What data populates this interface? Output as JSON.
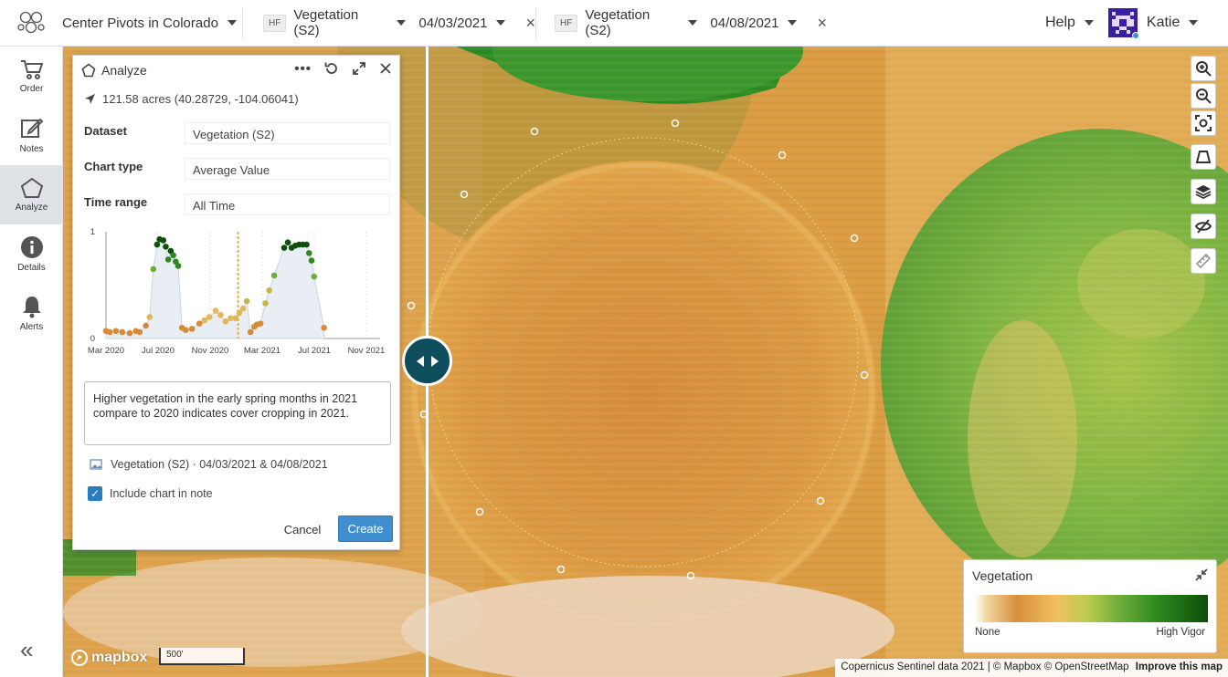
{
  "project": {
    "name": "Center Pivots in Colorado"
  },
  "layer_left": {
    "badge": "HF",
    "dataset": "Vegetation (S2)",
    "date": "04/03/2021",
    "close": "×"
  },
  "layer_right": {
    "badge": "HF",
    "dataset": "Vegetation (S2)",
    "date": "04/08/2021",
    "close": "×"
  },
  "help": {
    "label": "Help"
  },
  "user": {
    "name": "Katie"
  },
  "sidebar": {
    "items": [
      {
        "label": "Order",
        "icon": "cart-icon"
      },
      {
        "label": "Notes",
        "icon": "edit-icon"
      },
      {
        "label": "Analyze",
        "icon": "polygon-icon",
        "active": true
      },
      {
        "label": "Details",
        "icon": "info-icon"
      },
      {
        "label": "Alerts",
        "icon": "bell-icon"
      }
    ],
    "collapse": "«"
  },
  "panel": {
    "title": "Analyze",
    "location": "121.58 acres (40.28729, -104.06041)",
    "fields": {
      "dataset": {
        "label": "Dataset",
        "value": "Vegetation (S2)"
      },
      "chart_type": {
        "label": "Chart type",
        "value": "Average Value"
      },
      "time_range": {
        "label": "Time range",
        "value": "All Time"
      }
    },
    "note": "Higher vegetation in the early spring months in 2021 compare to 2020 indicates cover cropping in 2021.",
    "attachment": "Vegetation (S2) · 04/03/2021 & 04/08/2021",
    "include_chart": {
      "label": "Include chart in note",
      "checked": true
    },
    "cancel": "Cancel",
    "create": "Create"
  },
  "chart_data": {
    "type": "scatter",
    "x_tick_labels": [
      "Mar 2020",
      "Jul 2020",
      "Nov 2020",
      "Mar 2021",
      "Jul 2021",
      "Nov 2021"
    ],
    "y_tick_labels": [
      "0",
      "1"
    ],
    "ylim": [
      0,
      1
    ],
    "xlim": [
      0,
      22
    ],
    "marker_line_x": 10.6,
    "points": [
      {
        "x": 0.0,
        "y": 0.07
      },
      {
        "x": 0.3,
        "y": 0.06
      },
      {
        "x": 0.8,
        "y": 0.07
      },
      {
        "x": 1.3,
        "y": 0.06
      },
      {
        "x": 1.9,
        "y": 0.05
      },
      {
        "x": 2.4,
        "y": 0.07
      },
      {
        "x": 2.7,
        "y": 0.06
      },
      {
        "x": 3.2,
        "y": 0.12
      },
      {
        "x": 3.5,
        "y": 0.2
      },
      {
        "x": 3.8,
        "y": 0.65
      },
      {
        "x": 4.1,
        "y": 0.88
      },
      {
        "x": 4.3,
        "y": 0.93
      },
      {
        "x": 4.6,
        "y": 0.92
      },
      {
        "x": 4.8,
        "y": 0.86
      },
      {
        "x": 5.0,
        "y": 0.74
      },
      {
        "x": 5.2,
        "y": 0.82
      },
      {
        "x": 5.4,
        "y": 0.78
      },
      {
        "x": 5.6,
        "y": 0.72
      },
      {
        "x": 5.8,
        "y": 0.68
      },
      {
        "x": 6.1,
        "y": 0.1
      },
      {
        "x": 6.4,
        "y": 0.08
      },
      {
        "x": 6.9,
        "y": 0.09
      },
      {
        "x": 7.5,
        "y": 0.14
      },
      {
        "x": 7.9,
        "y": 0.17
      },
      {
        "x": 8.3,
        "y": 0.2
      },
      {
        "x": 8.8,
        "y": 0.26
      },
      {
        "x": 9.2,
        "y": 0.22
      },
      {
        "x": 9.6,
        "y": 0.16
      },
      {
        "x": 10.0,
        "y": 0.19
      },
      {
        "x": 10.4,
        "y": 0.19
      },
      {
        "x": 10.7,
        "y": 0.24
      },
      {
        "x": 11.0,
        "y": 0.28
      },
      {
        "x": 11.3,
        "y": 0.35
      },
      {
        "x": 11.6,
        "y": 0.06
      },
      {
        "x": 11.9,
        "y": 0.11
      },
      {
        "x": 12.1,
        "y": 0.13
      },
      {
        "x": 12.4,
        "y": 0.14
      },
      {
        "x": 12.8,
        "y": 0.33
      },
      {
        "x": 13.1,
        "y": 0.45
      },
      {
        "x": 13.5,
        "y": 0.59
      },
      {
        "x": 14.3,
        "y": 0.85
      },
      {
        "x": 14.6,
        "y": 0.9
      },
      {
        "x": 14.9,
        "y": 0.85
      },
      {
        "x": 15.2,
        "y": 0.87
      },
      {
        "x": 15.5,
        "y": 0.88
      },
      {
        "x": 15.8,
        "y": 0.88
      },
      {
        "x": 16.1,
        "y": 0.88
      },
      {
        "x": 16.3,
        "y": 0.8
      },
      {
        "x": 16.5,
        "y": 0.73
      },
      {
        "x": 16.7,
        "y": 0.58
      },
      {
        "x": 17.5,
        "y": 0.1
      }
    ]
  },
  "legend": {
    "title": "Vegetation",
    "min_label": "None",
    "max_label": "High Vigor"
  },
  "scale_bar": {
    "label": "500'"
  },
  "mapbox_logo": {
    "label": "mapbox"
  },
  "attribution": {
    "text": "Copernicus Sentinel data 2021 | © Mapbox © OpenStreetMap",
    "link": "Improve this map"
  },
  "colors": {
    "accent": "#3f8fd0",
    "handle": "#0d4d5c",
    "low_veg": "#d8903a",
    "high_veg": "#0e4d0a"
  }
}
